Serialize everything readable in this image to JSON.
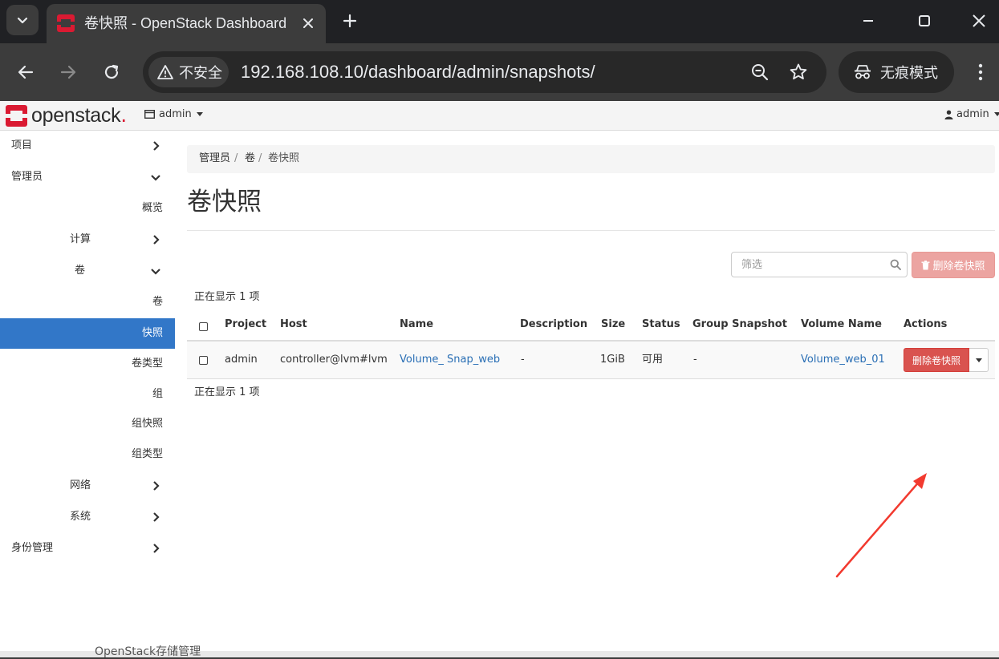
{
  "browser": {
    "tab_title": "卷快照 - OpenStack Dashboard",
    "url": "192.168.108.10/dashboard/admin/snapshots/",
    "security_label": "不安全",
    "incognito_label": "无痕模式"
  },
  "header": {
    "logo_text": "openstack",
    "logo_dot": ".",
    "project_label": "admin",
    "user_label": "admin"
  },
  "sidebar": {
    "items": [
      {
        "label": "项目"
      },
      {
        "label": "管理员"
      },
      {
        "label": "概览"
      },
      {
        "label": "计算"
      },
      {
        "label": "卷"
      },
      {
        "label": "卷"
      },
      {
        "label": "快照"
      },
      {
        "label": "卷类型"
      },
      {
        "label": "组"
      },
      {
        "label": "组快照"
      },
      {
        "label": "组类型"
      },
      {
        "label": "网络"
      },
      {
        "label": "系统"
      },
      {
        "label": "身份管理"
      }
    ]
  },
  "breadcrumb": [
    "管理员",
    "卷",
    "卷快照"
  ],
  "breadcrumb_sep": "/",
  "page_title": "卷快照",
  "filter_placeholder": "筛选",
  "delete_button_label": "删除卷快照",
  "count_text": "正在显示 1 项",
  "table": {
    "columns": [
      "Project",
      "Host",
      "Name",
      "Description",
      "Size",
      "Status",
      "Group Snapshot",
      "Volume Name",
      "Actions"
    ],
    "rows": [
      {
        "project": "admin",
        "host": "controller@lvm#lvm",
        "name": "Volume_ Snap_web",
        "description": "-",
        "size": "1GiB",
        "status": "可用",
        "group_snapshot": "-",
        "volume_name": "Volume_web_01",
        "action_label": "删除卷快照"
      }
    ]
  },
  "taskbar_text": "OpenStack存储管理",
  "colors": {
    "accent": "#3277c8",
    "danger": "#d9534f",
    "link": "#2a6fb5",
    "annotation_arrow": "#f23a2f"
  }
}
